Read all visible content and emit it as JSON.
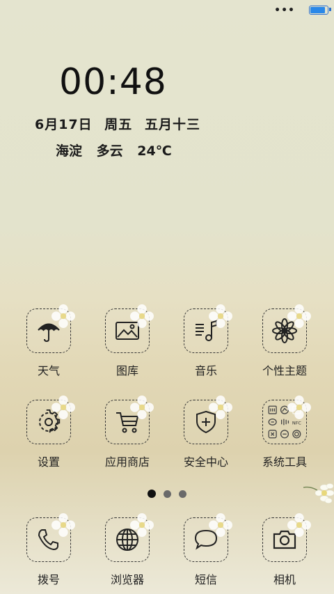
{
  "status_bar": {
    "signal_dots": "•••",
    "battery_level": 0.95,
    "battery_color": "#2a88e8"
  },
  "lockclock": {
    "time": "00:48",
    "date": "6月17日",
    "weekday": "周五",
    "lunar": "五月十三",
    "location": "海淀",
    "weather": "多云",
    "temperature": "24℃"
  },
  "apps": [
    {
      "label": "天气",
      "icon": "umbrella-icon"
    },
    {
      "label": "图库",
      "icon": "picture-icon"
    },
    {
      "label": "音乐",
      "icon": "music-note-icon"
    },
    {
      "label": "个性主题",
      "icon": "flower-icon"
    },
    {
      "label": "设置",
      "icon": "gear-icon"
    },
    {
      "label": "应用商店",
      "icon": "shopping-cart-icon"
    },
    {
      "label": "安全中心",
      "icon": "shield-plus-icon"
    },
    {
      "label": "系统工具",
      "icon": "tools-folder-icon"
    }
  ],
  "page_indicator": {
    "pages": 3,
    "current": 1
  },
  "dock": [
    {
      "label": "拨号",
      "icon": "phone-icon"
    },
    {
      "label": "浏览器",
      "icon": "globe-icon"
    },
    {
      "label": "短信",
      "icon": "chat-bubble-icon"
    },
    {
      "label": "相机",
      "icon": "camera-icon"
    }
  ]
}
